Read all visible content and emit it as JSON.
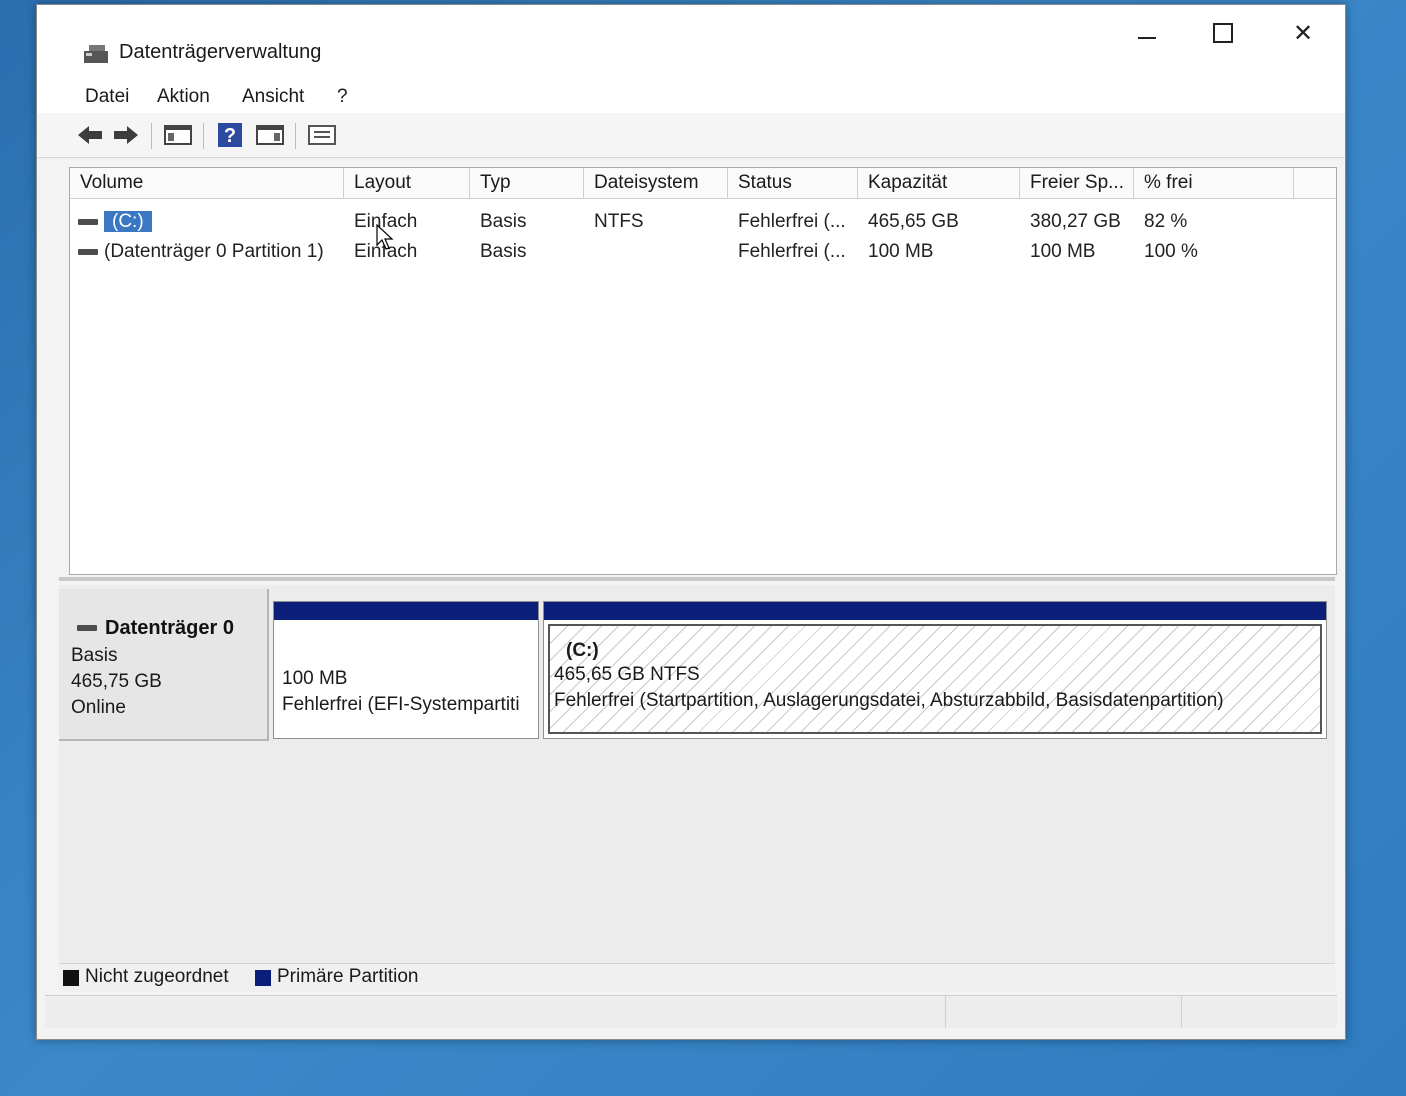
{
  "window": {
    "title": "Datenträgerverwaltung"
  },
  "menu": {
    "items": [
      "Datei",
      "Aktion",
      "Ansicht",
      "?"
    ]
  },
  "toolbar": {
    "icons": [
      "back-arrow-icon",
      "forward-arrow-icon",
      "console-tree-icon",
      "help-icon",
      "action-pane-icon",
      "properties-icon"
    ],
    "help_glyph": "?"
  },
  "volume_list": {
    "columns": [
      "Volume",
      "Layout",
      "Typ",
      "Dateisystem",
      "Status",
      "Kapazität",
      "Freier Sp...",
      "% frei"
    ],
    "rows": [
      {
        "volume": "(C:)",
        "layout": "Einfach",
        "typ": "Basis",
        "dateisystem": "NTFS",
        "status": "Fehlerfrei (...",
        "kapazitaet": "465,65 GB",
        "frei": "380,27 GB",
        "prozent": "82 %"
      },
      {
        "volume": "(Datenträger 0 Partition 1)",
        "layout": "Einfach",
        "typ": "Basis",
        "dateisystem": "",
        "status": "Fehlerfrei (...",
        "kapazitaet": "100 MB",
        "frei": "100 MB",
        "prozent": "100 %"
      }
    ]
  },
  "disk0": {
    "name": "Datenträger 0",
    "type": "Basis",
    "size": "465,75 GB",
    "state": "Online",
    "partitions": [
      {
        "label": "",
        "size": "100 MB",
        "status": "Fehlerfrei (EFI-Systempartiti"
      },
      {
        "label": "(C:)",
        "size": "465,65 GB NTFS",
        "status": "Fehlerfrei (Startpartition, Auslagerungsdatei, Absturzabbild, Basisdatenpartition)"
      }
    ]
  },
  "legend": {
    "items": [
      {
        "label": "Nicht zugeordnet",
        "color": "#111111"
      },
      {
        "label": "Primäre Partition",
        "color": "#0b1f7a"
      }
    ]
  },
  "colors": {
    "partition_bar": "#0b1f7a",
    "selection": "#3a78c4"
  }
}
